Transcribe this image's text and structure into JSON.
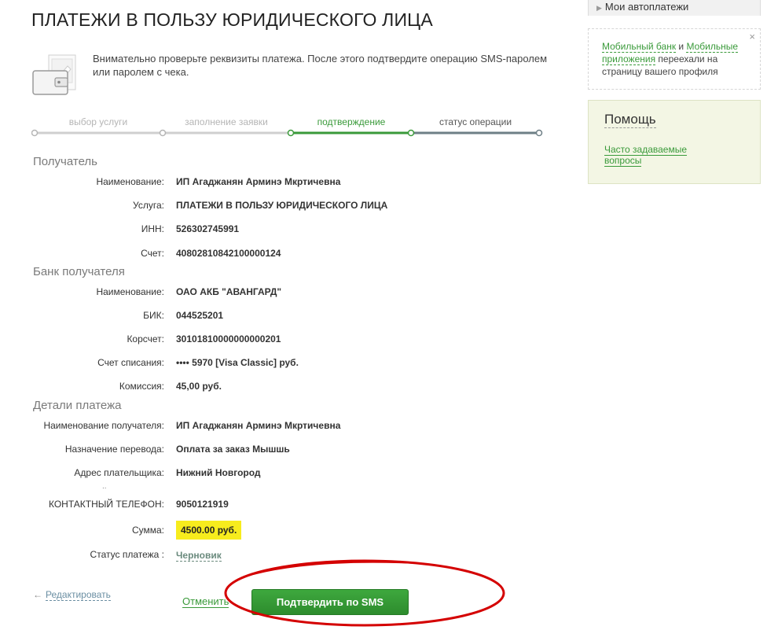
{
  "page": {
    "title": "ПЛАТЕЖИ В ПОЛЬЗУ ЮРИДИЧЕСКОГО ЛИЦА",
    "intro": "Внимательно проверьте реквизиты платежа. После этого подтвердите операцию SMS-паролем или паролем с чека."
  },
  "steps": [
    {
      "label": "выбор услуги",
      "state": "done"
    },
    {
      "label": "заполнение заявки",
      "state": "done"
    },
    {
      "label": "подтверждение",
      "state": "current"
    },
    {
      "label": "статус операции",
      "state": "pending"
    }
  ],
  "recipient": {
    "title": "Получатель",
    "fields": [
      {
        "label": "Наименование:",
        "value": "ИП Агаджанян Арминэ Мкртичевна"
      },
      {
        "label": "Услуга:",
        "value": "ПЛАТЕЖИ В ПОЛЬЗУ ЮРИДИЧЕСКОГО ЛИЦА"
      },
      {
        "label": "ИНН:",
        "value": "526302745991"
      },
      {
        "label": "Счет:",
        "value": "40802810842100000124"
      }
    ]
  },
  "bank": {
    "title": "Банк получателя",
    "fields": [
      {
        "label": "Наименование:",
        "value": "ОАО АКБ \"АВАНГАРД\""
      },
      {
        "label": "БИК:",
        "value": "044525201"
      },
      {
        "label": "Корсчет:",
        "value": "30101810000000000201"
      },
      {
        "label": "Счет списания:",
        "value": "•••• 5970  [Visa Classic]  руб."
      },
      {
        "label": "Комиссия:",
        "value": "45,00 руб."
      }
    ]
  },
  "details": {
    "title": "Детали платежа",
    "fields": [
      {
        "label": "Наименование получателя:",
        "value": "ИП Агаджанян Арминэ Мкртичевна"
      },
      {
        "label": "Назначение перевода:",
        "value": "Оплата за заказ Мышшь"
      },
      {
        "label": "Адрес плательщика:",
        "value": "Нижний Новгород"
      },
      {
        "label": "КОНТАКТНЫЙ ТЕЛЕФОН:",
        "value": "9050121919"
      }
    ],
    "dots": "..",
    "amount_label": "Сумма:",
    "amount_value": "4500.00 руб.",
    "status_label": "Статус платежа :",
    "status_value": "Черновик"
  },
  "actions": {
    "edit_arrow": "←",
    "edit": "Редактировать",
    "cancel": "Отменить",
    "confirm": "Подтвердить по SMS"
  },
  "sidebar": {
    "autopay": "Мои автоплатежи",
    "notice_link1": "Мобильный банк",
    "notice_and": " и ",
    "notice_link2": "Мобильные приложения",
    "notice_rest": " переехали на страницу вашего профиля",
    "close": "×",
    "help_title": "Помощь",
    "help_link": "Часто задаваемые вопросы"
  },
  "colors": {
    "accent_green": "#3a9a3a",
    "amount_highlight": "#f7ec1d",
    "annotation_red": "#d40000"
  }
}
